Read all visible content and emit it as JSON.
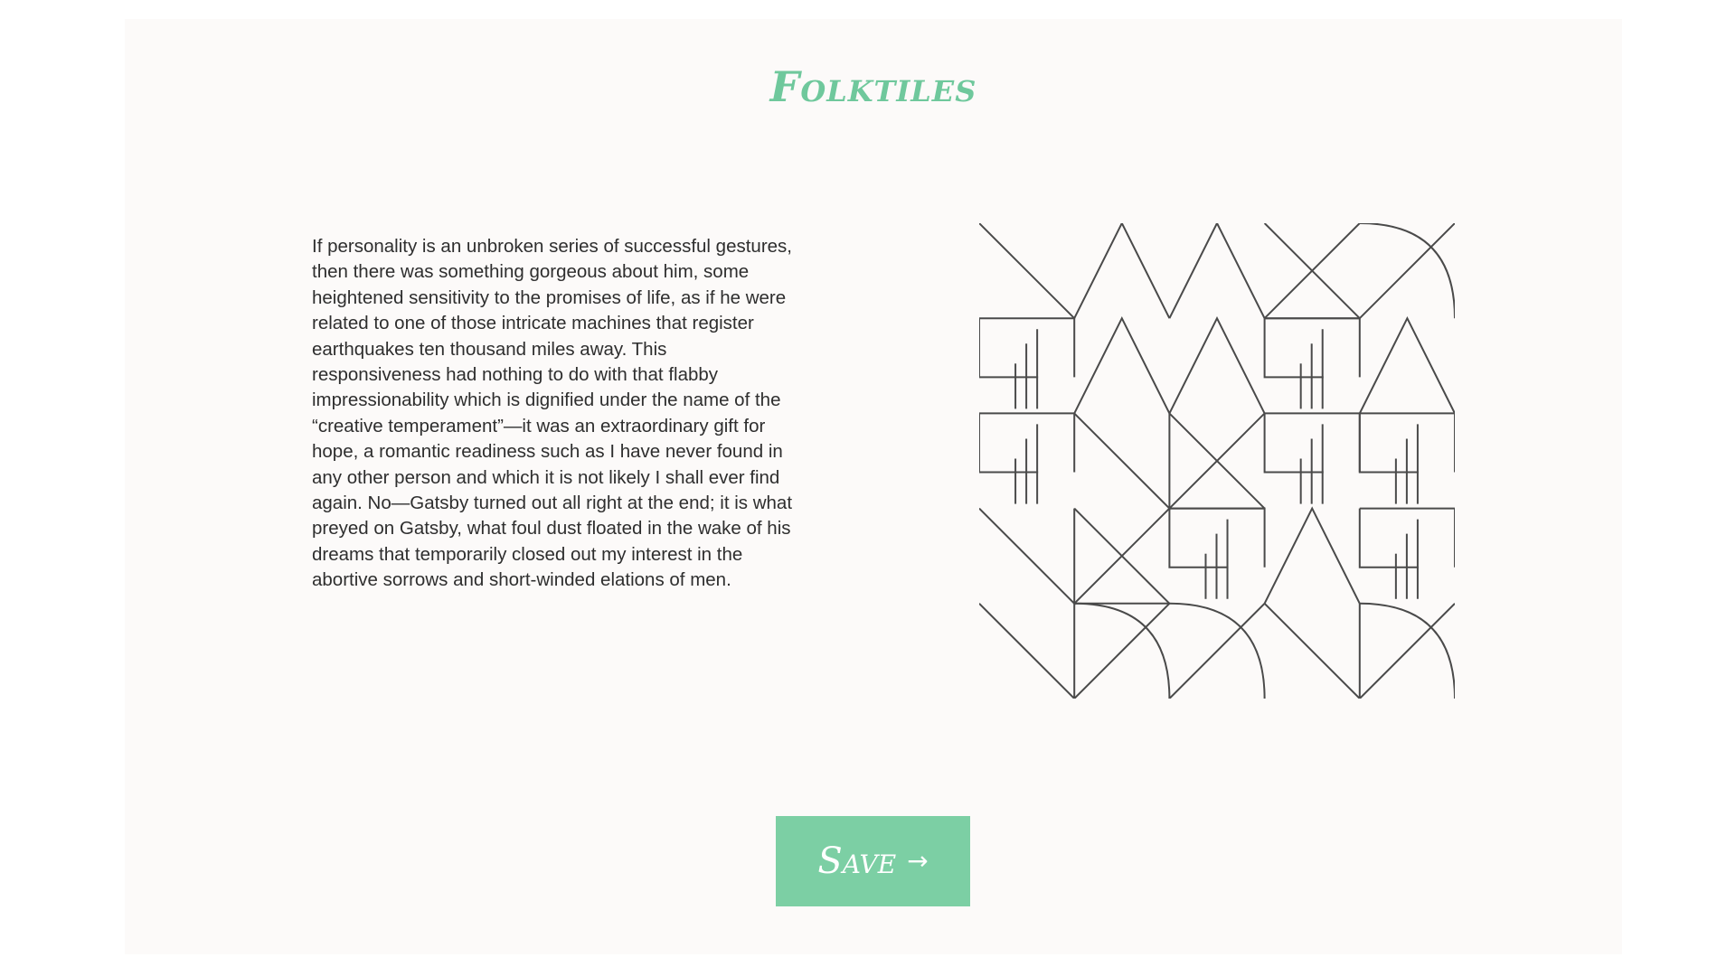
{
  "brand": {
    "name": "Folktiles",
    "color": "#6fc89c"
  },
  "content": {
    "quote": "If personality is an unbroken series of successful gestures, then there was something gorgeous about him, some heightened sensitivity to the promises of life, as if he were related to one of those intricate machines that register earthquakes ten thousand miles away. This responsiveness had nothing to do with that flabby impressionability which is dignified under the name of the “creative temperament”—it was an extraordinary gift for hope, a romantic readiness such as I have never found in any other person and which it is not likely I shall ever find again. No—Gatsby turned out all right at the end; it is what preyed on Gatsby, what foul dust floated in the wake of his dreams that temporarily closed out my interest in the abortive sorrows and short-winded elations of men."
  },
  "pattern": {
    "rows": [
      [
        "zig",
        "triangle",
        "triangle",
        "x-cross",
        "arc-diag"
      ],
      [
        "box",
        "triangle",
        "triangle",
        "box",
        "triangle"
      ],
      [
        "box",
        "diag",
        "x-cross",
        "box",
        "box"
      ],
      [
        "diag",
        "x-cross",
        "box",
        "triangle",
        "box"
      ],
      [
        "diag",
        "arc-diag",
        "arc-diag",
        "diag",
        "arc-diag"
      ]
    ],
    "stroke_color": "#4a4a4a"
  },
  "actions": {
    "save_label": "Save",
    "save_icon": "arrow-right-icon",
    "button_color": "#7ccfa4"
  }
}
